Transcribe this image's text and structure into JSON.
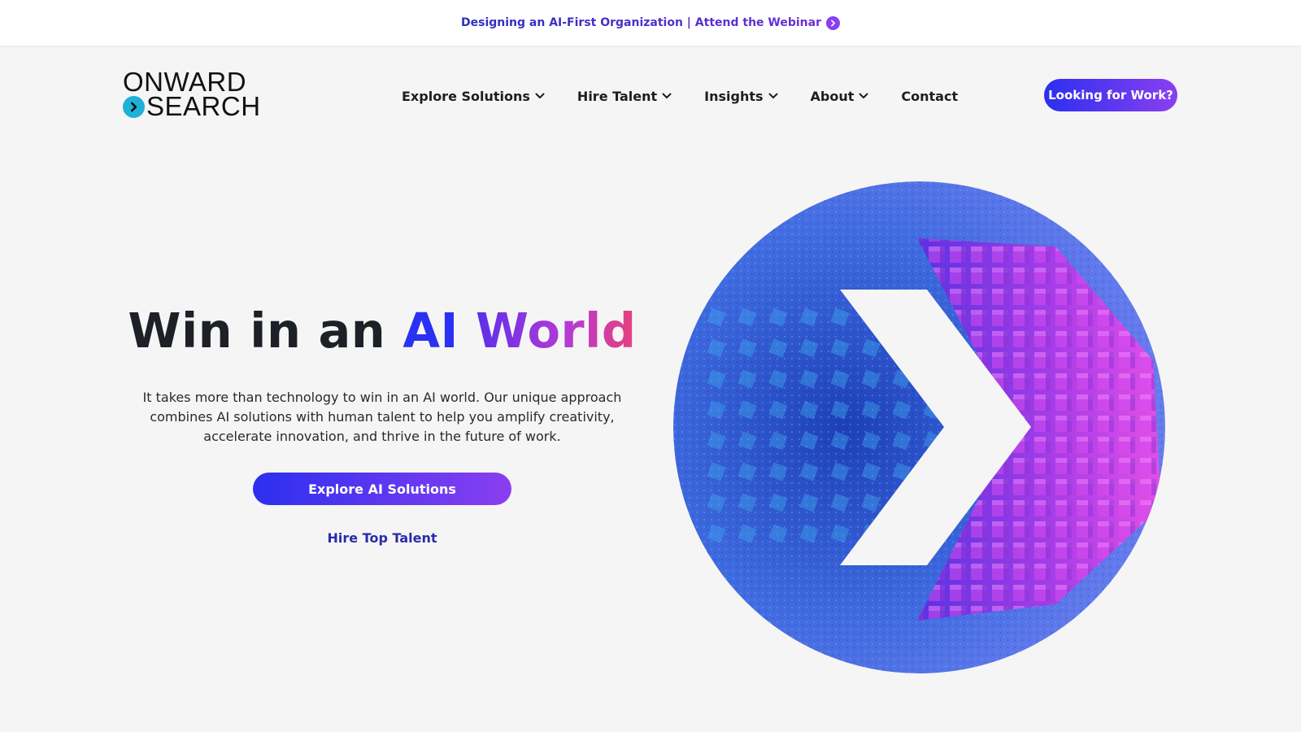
{
  "announcement": {
    "text": "Designing an AI-First Organization | Attend the Webinar",
    "icon": "chevron-right-circle-icon"
  },
  "header": {
    "logo": {
      "line1": "ONWARD",
      "line2": "SEARCH",
      "mark_color": "#1eb1d8"
    },
    "nav": [
      {
        "label": "Explore Solutions",
        "has_dropdown": true
      },
      {
        "label": "Hire Talent",
        "has_dropdown": true
      },
      {
        "label": "Insights",
        "has_dropdown": true
      },
      {
        "label": "About",
        "has_dropdown": true
      },
      {
        "label": "Contact",
        "has_dropdown": false
      }
    ],
    "cta_label": "Looking for Work?"
  },
  "hero": {
    "title_prefix": "Win in an",
    "title_ai": "AI",
    "title_world": "World",
    "description": "It takes more than technology to win in an AI world. Our unique approach combines AI solutions with human talent to help you amplify creativity, accelerate innovation, and thrive in the future of work.",
    "primary_cta": "Explore AI Solutions",
    "secondary_cta": "Hire Top Talent",
    "image_icon": "arrow-chevron-particles-illustration"
  },
  "colors": {
    "accent_blue": "#2c2ff0",
    "accent_purple": "#8a3ff0",
    "accent_pink": "#e8407a",
    "background": "#f5f5f5"
  }
}
